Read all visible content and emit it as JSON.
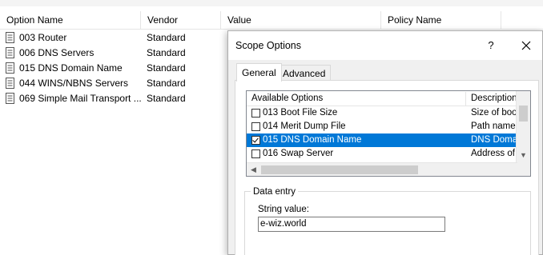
{
  "listview": {
    "columns": [
      "Option Name",
      "Vendor",
      "Value",
      "Policy Name"
    ],
    "rows": [
      {
        "name": "003 Router",
        "vendor": "Standard"
      },
      {
        "name": "006 DNS Servers",
        "vendor": "Standard"
      },
      {
        "name": "015 DNS Domain Name",
        "vendor": "Standard"
      },
      {
        "name": "044 WINS/NBNS Servers",
        "vendor": "Standard"
      },
      {
        "name": "069 Simple Mail Transport ...",
        "vendor": "Standard"
      }
    ]
  },
  "dialog": {
    "title": "Scope Options",
    "help_label": "?",
    "close_icon": "close-icon",
    "tabs": [
      {
        "label": "General",
        "active": true
      },
      {
        "label": "Advanced",
        "active": false
      }
    ],
    "available_options": {
      "columns": [
        "Available Options",
        "Description"
      ],
      "rows": [
        {
          "name": "013 Boot File Size",
          "description": "Size of boot",
          "checked": false,
          "selected": false
        },
        {
          "name": "014 Merit Dump File",
          "description": "Path name f",
          "checked": false,
          "selected": false
        },
        {
          "name": "015 DNS Domain Name",
          "description": "DNS Domai",
          "checked": true,
          "selected": true
        },
        {
          "name": "016 Swap Server",
          "description": "Address of c",
          "checked": false,
          "selected": false
        }
      ]
    },
    "data_entry": {
      "group_label": "Data entry",
      "string_label": "String value:",
      "string_value": "e-wiz.world"
    }
  },
  "colors": {
    "selection": "#0078d7",
    "dialog_bg": "#f0f0f0",
    "border": "#adadad"
  }
}
